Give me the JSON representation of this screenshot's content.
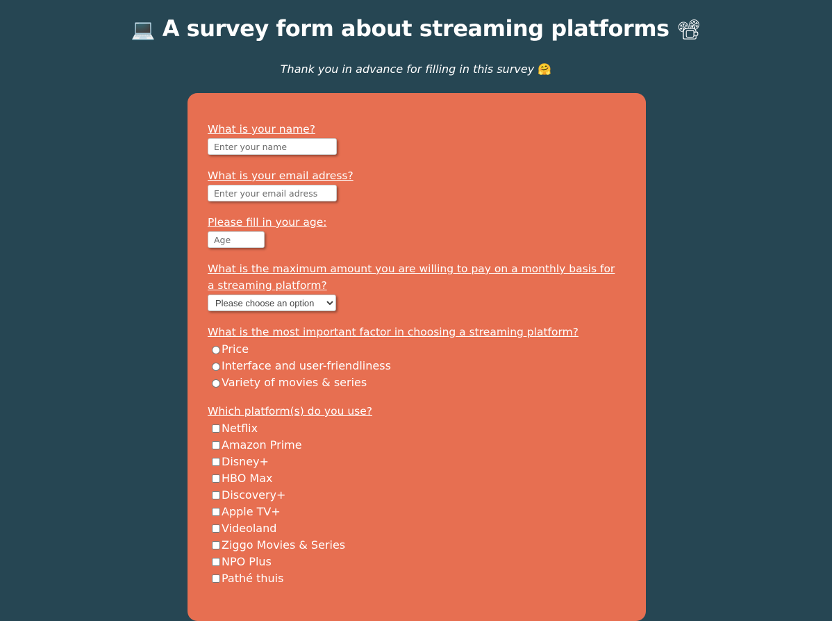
{
  "header": {
    "title": "A survey form about streaming platforms",
    "title_emoji_left": "💻",
    "title_emoji_right": "📽",
    "subtitle": "Thank you in advance for filling in this survey",
    "subtitle_emoji": "🤗"
  },
  "form": {
    "name": {
      "label": "What is your name?",
      "placeholder": "Enter your name",
      "value": ""
    },
    "email": {
      "label": "What is your email adress?",
      "placeholder": "Enter your email adress",
      "value": ""
    },
    "age": {
      "label": "Please fill in your age:",
      "placeholder": "Age",
      "value": ""
    },
    "budget": {
      "label": "What is the maximum amount you are willing to pay on a monthly basis for a streaming platform?",
      "selected": "Please choose an option"
    },
    "factor": {
      "label": "What is the most important factor in choosing a streaming platform?",
      "options": [
        "Price",
        "Interface and user-friendliness",
        "Variety of movies & series"
      ]
    },
    "platforms": {
      "label": "Which platform(s) do you use?",
      "options": [
        "Netflix",
        "Amazon Prime",
        "Disney+",
        "HBO Max",
        "Discovery+",
        "Apple TV+",
        "Videoland",
        "Ziggo Movies & Series",
        "NPO Plus",
        "Pathé thuis"
      ]
    }
  },
  "colors": {
    "background": "#264653",
    "card": "#e76f51",
    "text": "#ffffff"
  }
}
